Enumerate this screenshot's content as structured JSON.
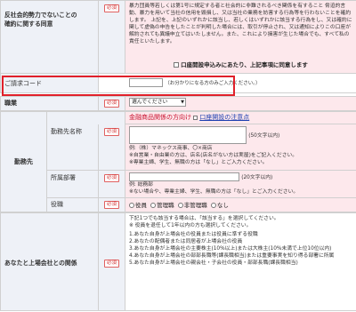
{
  "required_label": "必須",
  "antisocial": {
    "label": "反社会的勢力でないことの\n確約に関する同意",
    "text": "暴力団員等若しくは第1号に規定する者と社会的に非難されるべき関係を有すること\n脅迫的言動、暴力を用いて当社の信用を毀損し、又は当社の業務を妨害する行為等を行わないことを確約します。\n上記を、上記のいずれかに該当し、若しくはいずれかに該当する行為をし、又は確約に関して虚偽の申告をしたことが判明した場合には、取引が停止され、又は通知によりこの口座が解約されても異議申立てはいたしません。また、これにより損害が生じた場合でも、すべて私の責任といたします。",
    "agree_label": "口座開設申込みにあたり、上記事項に同意します"
  },
  "request_code": {
    "label": "ご請求コード",
    "hint": "（お分かりになる方のみご入力ください。）"
  },
  "occupation": {
    "label": "職業",
    "selected": "選んでください"
  },
  "workplace": {
    "section_label": "勤務先",
    "top_link_red": "金融商品関係の方向け",
    "top_link_blue": "口座開設の注意点",
    "name": {
      "label": "勤務先名称",
      "limit": "(50文字以内)",
      "example": "例:（株）マネックス商事、〇×商店",
      "note1": "※自営業・自由業の方は、店名(店名がない方は実屋)をご記入ください。",
      "note2": "※専業主婦、学生、無職の方は「なし」とご入力ください。"
    },
    "dept": {
      "label": "所属部署",
      "limit": "(20文字以内)",
      "example": "例: 総務部",
      "note": "※ない場合や、専業主婦、学生、無職の方は「なし」とご入力ください。"
    },
    "position": {
      "label": "役職",
      "options": [
        "役員",
        "管理職",
        "非管理職",
        "なし"
      ]
    }
  },
  "listed_company": {
    "label": "あなたと上場会社との関係",
    "intro": "下記1つでも該当する場合は、「該当する」を選択してください。",
    "sub": "※ 役員を退任して1年以内の方も選択してください。",
    "items": [
      "1.あなた自身が上場会社の役員または役員に準ずる役職",
      "2.あなたの配偶者または同居者が上場会社の役員",
      "3.あなた自身が上場会社の主要株主(10%以上)または大株主(10%未満で上位10位以内)",
      "4.あなた自身が上場会社の部部長職等(課長職相当)または重要事実を知り得る部署に所属",
      "5.あなた自身が上場会社の親会社・子会社の役員・部部長職(課長職相当)"
    ]
  }
}
